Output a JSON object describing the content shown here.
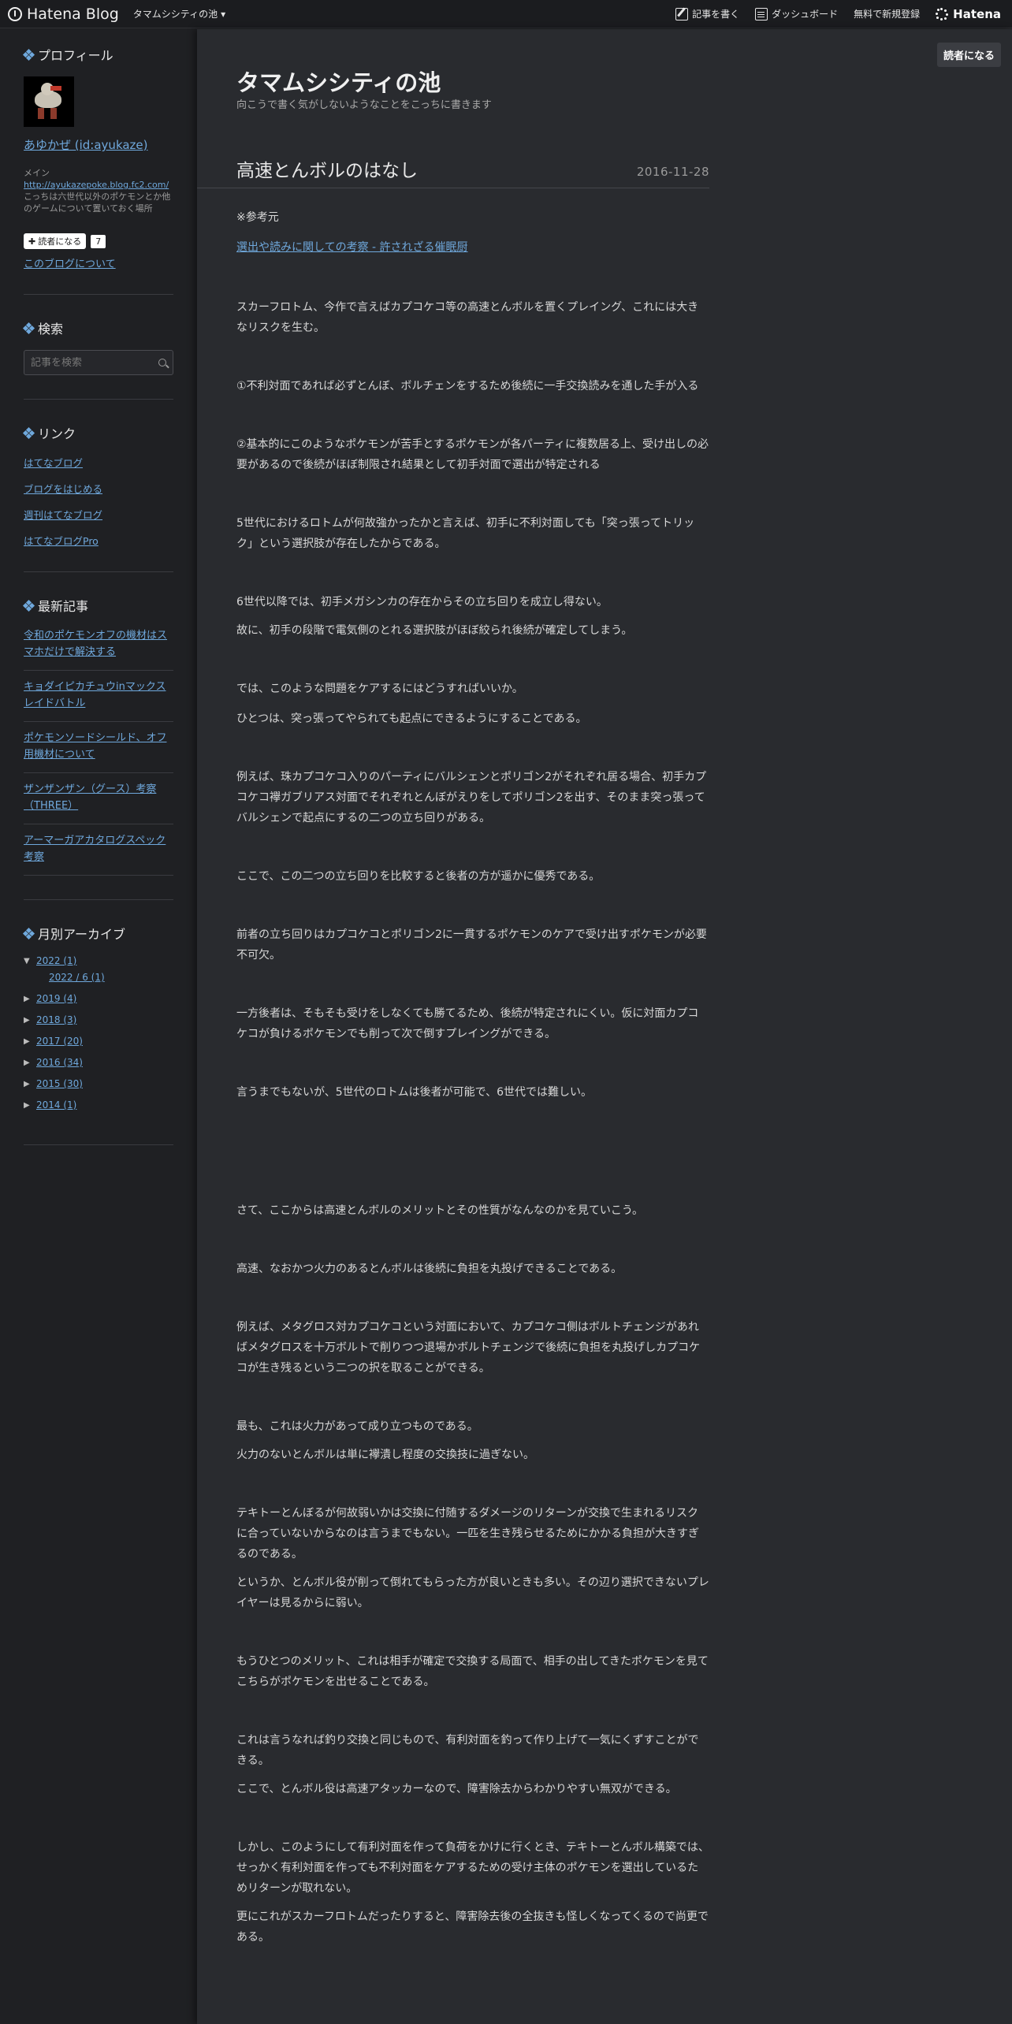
{
  "topbar": {
    "logo_text": "Hatena Blog",
    "blog_menu": "タマムシシティの池",
    "write_label": "記事を書く",
    "dashboard_label": "ダッシュボード",
    "signup_label": "無料で新規登録",
    "hatena_label": "Hatena"
  },
  "sidebar": {
    "profile_title": "プロフィール",
    "user_name": "あゆかぜ (id:ayukaze)",
    "desc_prefix": "メイン",
    "desc_url": "http://ayukazepoke.blog.fc2.com/",
    "desc_text": "こっちは六世代以外のポケモンとか他のゲームについて置いておく場所",
    "reader_btn": "読者になる",
    "reader_count": "7",
    "about_link": "このブログについて",
    "search_title": "検索",
    "search_placeholder": "記事を検索",
    "links_title": "リンク",
    "links": [
      "はてなブログ",
      "ブログをはじめる",
      "週刊はてなブログ",
      "はてなブログPro"
    ],
    "recent_title": "最新記事",
    "recent": [
      "令和のポケモンオフの機材はスマホだけで解決する",
      "キョダイピカチュウinマックスレイドバトル",
      "ポケモンソードシールド、オフ用機材について",
      "ザンザンザン（グース）考察（THREE）",
      "アーマーガアカタログスペック考察"
    ],
    "archive_title": "月別アーカイブ",
    "archive": [
      {
        "label": "2022 (1)",
        "open": "▼"
      },
      {
        "label": "2019 (4)",
        "open": "▶"
      },
      {
        "label": "2018 (3)",
        "open": "▶"
      },
      {
        "label": "2017 (20)",
        "open": "▶"
      },
      {
        "label": "2016 (34)",
        "open": "▶"
      },
      {
        "label": "2015 (30)",
        "open": "▶"
      },
      {
        "label": "2014 (1)",
        "open": "▶"
      }
    ],
    "archive_sub": "2022 / 6 (1)"
  },
  "main": {
    "subscribe": "読者になる",
    "blog_title": "タマムシシティの池",
    "blog_desc": "向こうで書く気がしないようなことをこっちに書きます",
    "entry_title": "高速とんボルのはなし",
    "entry_date": "2016-11-28",
    "ref_label": "※参考元",
    "ref_link": "選出や読みに関しての考察 - 許されざる催眠厨",
    "p1": "スカーフロトム、今作で言えばカプコケコ等の高速とんボルを置くプレイング、これには大きなリスクを生む。",
    "p2": "①不利対面であれば必ずとんぼ、ボルチェンをするため後続に一手交換読みを通した手が入る",
    "p3": "②基本的にこのようなポケモンが苦手とするポケモンが各パーティに複数居る上、受け出しの必要があるので後続がほぼ制限され結果として初手対面で選出が特定される",
    "p4": "5世代におけるロトムが何故強かったかと言えば、初手に不利対面しても「突っ張ってトリック」という選択肢が存在したからである。",
    "p5a": "6世代以降では、初手メガシンカの存在からその立ち回りを成立し得ない。",
    "p5b": "故に、初手の段階で電気側のとれる選択肢がほぼ絞られ後続が確定してしまう。",
    "p6a": "では、このような問題をケアするにはどうすればいいか。",
    "p6b": "ひとつは、突っ張ってやられても起点にできるようにすることである。",
    "p7": "例えば、珠カプコケコ入りのパーティにバルシェンとポリゴン2がそれぞれ居る場合、初手カプコケコ襷ガブリアス対面でそれぞれとんぼがえりをしてポリゴン2を出す、そのまま突っ張ってバルシェンで起点にするの二つの立ち回りがある。",
    "p8": "ここで、この二つの立ち回りを比較すると後者の方が遥かに優秀である。",
    "p9": "前者の立ち回りはカプコケコとポリゴン2に一貫するポケモンのケアで受け出すポケモンが必要不可欠。",
    "p10": "一方後者は、そもそも受けをしなくても勝てるため、後続が特定されにくい。仮に対面カプコケコが負けるポケモンでも削って次で倒すプレイングができる。",
    "p11": "言うまでもないが、5世代のロトムは後者が可能で、6世代では難しい。",
    "p12": "さて、ここからは高速とんボルのメリットとその性質がなんなのかを見ていこう。",
    "p13": "高速、なおかつ火力のあるとんボルは後続に負担を丸投げできることである。",
    "p14": "例えば、メタグロス対カプコケコという対面において、カプコケコ側はボルトチェンジがあればメタグロスを十万ボルトで削りつつ退場かボルトチェンジで後続に負担を丸投げしカプコケコが生き残るという二つの択を取ることができる。",
    "p15a": "最も、これは火力があって成り立つものである。",
    "p15b": "火力のないとんボルは単に襷潰し程度の交換技に過ぎない。",
    "p16a": "テキトーとんぼるが何故弱いかは交換に付随するダメージのリターンが交換で生まれるリスクに合っていないからなのは言うまでもない。一匹を生き残らせるためにかかる負担が大きすぎるのである。",
    "p16b": "というか、とんボル役が削って倒れてもらった方が良いときも多い。その辺り選択できないプレイヤーは見るからに弱い。",
    "p17": "もうひとつのメリット、これは相手が確定で交換する局面で、相手の出してきたポケモンを見てこちらがポケモンを出せることである。",
    "p18a": "これは言うなれば釣り交換と同じもので、有利対面を釣って作り上げて一気にくずすことができる。",
    "p18b": "ここで、とんボル役は高速アタッカーなので、障害除去からわかりやすい無双ができる。",
    "p19": "しかし、このようにして有利対面を作って負荷をかけに行くとき、テキトーとんボル構築では、せっかく有利対面を作っても不利対面をケアするための受け主体のポケモンを選出しているためリターンが取れない。",
    "p20": "更にこれがスカーフロトムだったりすると、障害除去後の全抜きも怪しくなってくるので尚更である。"
  }
}
